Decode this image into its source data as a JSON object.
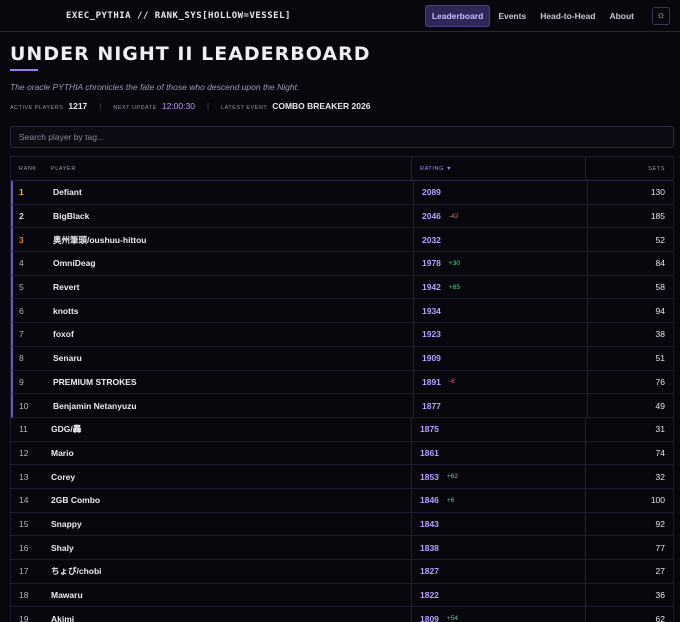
{
  "brand": "EXEC_PYTHIA // RANK_SYS[HOLLOW=VESSEL]",
  "nav": {
    "items": [
      "Leaderboard",
      "Events",
      "Head-to-Head",
      "About"
    ],
    "active": 0,
    "theme_icon": "sun-icon"
  },
  "page": {
    "title": "UNDER NIGHT II LEADERBOARD",
    "subtitle": "The oracle PYTHIA chronicles the fate of those who descend upon the Night."
  },
  "stats": {
    "active_players_label": "Active Players",
    "active_players": "1217",
    "next_update_label": "Next Update",
    "next_update": "12:00:30",
    "latest_event_label": "Latest Event",
    "latest_event": "COMBO BREAKER 2026"
  },
  "search": {
    "placeholder": "Search player by tag..."
  },
  "table": {
    "headers": {
      "rank": "Rank",
      "player": "Player",
      "rating": "Rating ▼",
      "sets": "Sets"
    },
    "rows": [
      {
        "rank": "1",
        "player": "Defiant",
        "rating": "2089",
        "delta": "",
        "sets": "130"
      },
      {
        "rank": "2",
        "player": "BigBlack",
        "rating": "2046",
        "delta": "-42",
        "sets": "185"
      },
      {
        "rank": "3",
        "player": "奥州筆頭/oushuu-hittou",
        "rating": "2032",
        "delta": "",
        "sets": "52"
      },
      {
        "rank": "4",
        "player": "OmniDeag",
        "rating": "1978",
        "delta": "+30",
        "sets": "84"
      },
      {
        "rank": "5",
        "player": "Revert",
        "rating": "1942",
        "delta": "+85",
        "sets": "58"
      },
      {
        "rank": "6",
        "player": "knotts",
        "rating": "1934",
        "delta": "",
        "sets": "94"
      },
      {
        "rank": "7",
        "player": "foxof",
        "rating": "1923",
        "delta": "",
        "sets": "38"
      },
      {
        "rank": "8",
        "player": "Senaru",
        "rating": "1909",
        "delta": "",
        "sets": "51"
      },
      {
        "rank": "9",
        "player": "PREMIUM STROKES",
        "rating": "1891",
        "delta": "-6",
        "sets": "76"
      },
      {
        "rank": "10",
        "player": "Benjamin Netanyuzu",
        "rating": "1877",
        "delta": "",
        "sets": "49"
      },
      {
        "rank": "11",
        "player": "GDG/轟",
        "rating": "1875",
        "delta": "",
        "sets": "31"
      },
      {
        "rank": "12",
        "player": "Mario",
        "rating": "1861",
        "delta": "",
        "sets": "74"
      },
      {
        "rank": "13",
        "player": "Corey",
        "rating": "1853",
        "delta": "+62",
        "sets": "32"
      },
      {
        "rank": "14",
        "player": "2GB Combo",
        "rating": "1846",
        "delta": "+6",
        "sets": "100"
      },
      {
        "rank": "15",
        "player": "Snappy",
        "rating": "1843",
        "delta": "",
        "sets": "92"
      },
      {
        "rank": "16",
        "player": "Shaly",
        "rating": "1838",
        "delta": "",
        "sets": "77"
      },
      {
        "rank": "17",
        "player": "ちょび/chobi",
        "rating": "1827",
        "delta": "",
        "sets": "27"
      },
      {
        "rank": "18",
        "player": "Mawaru",
        "rating": "1822",
        "delta": "",
        "sets": "36"
      },
      {
        "rank": "19",
        "player": "Akimi",
        "rating": "1809",
        "delta": "+54",
        "sets": "62"
      }
    ]
  },
  "colors": {
    "accent": "#9a7cf0",
    "gold": "#f0b24a",
    "bronze": "#d6813c",
    "up": "#4ddc8e",
    "down": "#ff5a74"
  }
}
